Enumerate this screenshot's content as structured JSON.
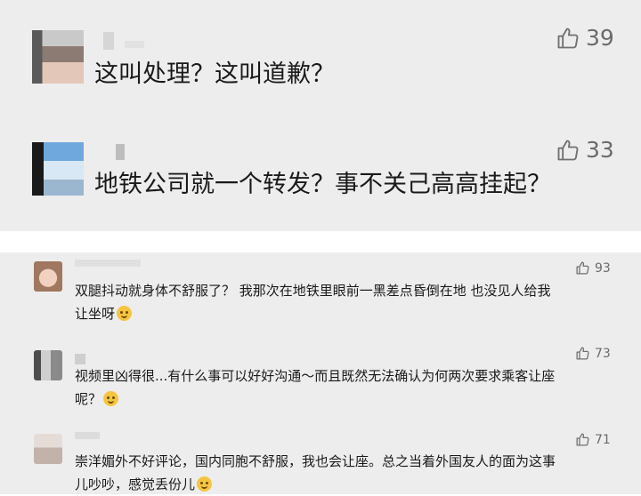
{
  "big_comments": [
    {
      "likes": "39",
      "text": "这叫处理？这叫道歉？"
    },
    {
      "likes": "33",
      "text": "地铁公司就一个转发？事不关己高高挂起？"
    }
  ],
  "small_comments": [
    {
      "likes": "93",
      "line1": "双腿抖动就身体不舒服了？ 我那次在地铁里眼前一黑差点昏倒在地 也没见人给我",
      "line2": "让坐呀"
    },
    {
      "likes": "73",
      "line1": "视频里凶得很...有什么事可以好好沟通～而且既然无法确认为何两次要求乘客让座",
      "line2": "呢？"
    },
    {
      "likes": "71",
      "line1": "崇洋媚外不好评论，国内同胞不舒服，我也会让座。总之当着外国友人的面为这事",
      "line2": "儿吵吵，感觉丢份儿"
    }
  ],
  "icons": {
    "like": "thumbs-up-icon",
    "emoji": "smiley-emoji-icon"
  },
  "colors": {
    "panel_bg": "#ededed",
    "separator": "#ffffff",
    "meta_gray": "#6b6b6b"
  }
}
